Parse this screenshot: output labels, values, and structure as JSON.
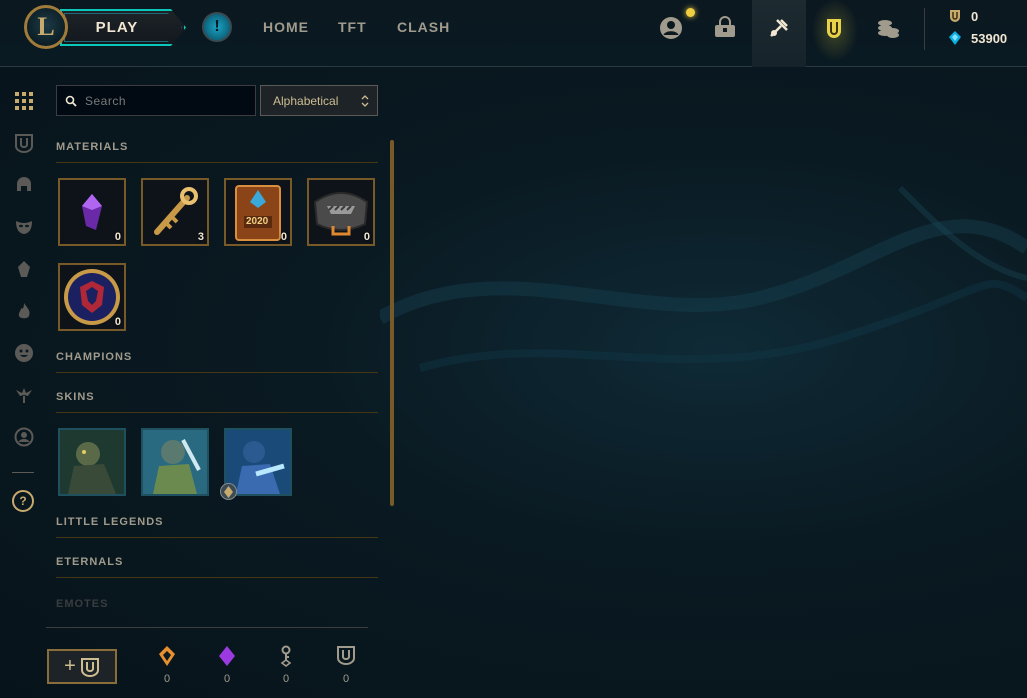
{
  "nav": {
    "play_label": "PLAY",
    "logo_letter": "L",
    "links": [
      "HOME",
      "TFT",
      "CLASH"
    ],
    "alert_symbol": "!",
    "icons": [
      "profile-icon",
      "collection-icon",
      "loot-icon",
      "store-icon",
      "coins-icon"
    ]
  },
  "currency": {
    "rp": "0",
    "be": "53900"
  },
  "search": {
    "placeholder": "Search",
    "sort_label": "Alphabetical"
  },
  "sections": {
    "materials": "MATERIALS",
    "champions": "CHAMPIONS",
    "skins": "SKINS",
    "little_legends": "LITTLE LEGENDS",
    "eternals": "ETERNALS",
    "emotes": "EMOTES"
  },
  "materials": [
    {
      "name": "gemstone",
      "count": "0"
    },
    {
      "name": "hextech-key",
      "count": "3"
    },
    {
      "name": "2020-card",
      "count": "0"
    },
    {
      "name": "chest",
      "count": "0"
    },
    {
      "name": "worlds-orb",
      "count": "0"
    }
  ],
  "materials_card_label": "2020",
  "skins": [
    {
      "name": "skin-1",
      "chroma": false
    },
    {
      "name": "skin-2",
      "chroma": false
    },
    {
      "name": "skin-3",
      "chroma": true
    }
  ],
  "footer": {
    "craft_plus": "+",
    "counts": [
      "0",
      "0",
      "0",
      "0"
    ]
  },
  "colors": {
    "gold": "#c8aa6e",
    "teal": "#0ac8b9",
    "rp_blue": "#0ab0e0"
  }
}
